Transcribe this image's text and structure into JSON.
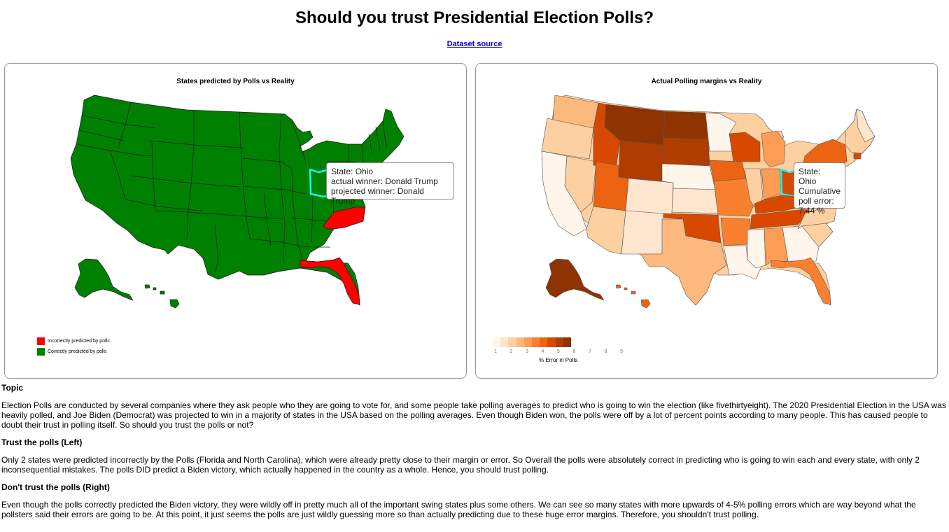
{
  "header": {
    "title": "Should you trust Presidential Election Polls?",
    "source_link": "Dataset source"
  },
  "left_panel": {
    "title": "States predicted by Polls vs Reality",
    "tooltip": {
      "line1": "State: Ohio",
      "line2": "actual winner: Donald Trump",
      "line3": "projected winner: Donald Trump"
    },
    "legend": [
      {
        "label": "Incorrectly predicted by polls",
        "color": "#ff0000"
      },
      {
        "label": "Correctly predicted by polls",
        "color": "#008000"
      }
    ],
    "colors": {
      "correct": "#008000",
      "incorrect": "#ff0000",
      "highlight": "#00ffff"
    }
  },
  "right_panel": {
    "title": "Actual Polling margins vs Reality",
    "tooltip": {
      "line1": "State: Ohio",
      "line2": "Cumulative",
      "line3": "poll error:",
      "line4": "7.44 %"
    },
    "scale_label": "% Error in Polls",
    "scale_ticks": [
      "1",
      "2",
      "3",
      "4",
      "5",
      "6",
      "7",
      "8",
      "9"
    ],
    "scale_colors": [
      "#fff5eb",
      "#fee6ce",
      "#fdd0a2",
      "#fdb97d",
      "#fd9c55",
      "#f98030",
      "#ec6411",
      "#d84801",
      "#b13c02",
      "#8f3303"
    ]
  },
  "content": {
    "topic_heading": "Topic",
    "topic_text": "Election Polls are conducted by several companies where they ask people who they are going to vote for, and some people take polling averages to predict who is going to win the election (like fivethirtyeight). The 2020 Presidential Election in the USA was heavily polled, and Joe Biden (Democrat) was projected to win in a majority of states in the USA based on the polling averages. Even though Biden won, the polls were off by a lot of percent points according to many people. This has caused people to doubt their trust in polling itself. So should you trust the polls or not?",
    "trust_heading": "Trust the polls (Left)",
    "trust_text": "Only 2 states were predicted incorrectly by the Polls (Florida and North Carolina), which were already pretty close to their margin or error. So Overall the polls were absolutely correct in predicting who is going to win each and every state, with only 2 inconsequential mistakes. The polls DID predict a Biden victory, which actually happened in the country as a whole. Hence, you should trust polling.",
    "distrust_heading": "Don't trust the polls (Right)",
    "distrust_text": "Even though the polls correctly predicted the Biden victory, they were wildly off in pretty much all of the important swing states plus some others. We can see so many states with more upwards of 4-5% polling errors which are way beyond what the pollsters said their errors are going to be. At this point, it just seems the polls are just wildly guessing more so than actually predicting due to these huge error margins. Therefore, you shouldn't trust polling."
  }
}
